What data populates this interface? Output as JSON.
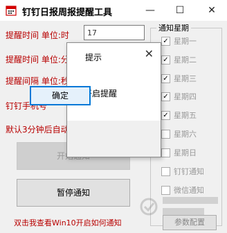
{
  "window": {
    "title": "钉钉日报周报提醒工具",
    "minimize": "—",
    "maximize": "☐",
    "close": "✕"
  },
  "form": {
    "row1_label": "提醒时间 单位:时",
    "row1_value": "17",
    "row2_label": "提醒时间 单位:分",
    "row3_label": "提醒间隔 单位:秒",
    "phone_label": "钉钉手机号",
    "auto_label": "默认3分钟后自动"
  },
  "buttons": {
    "start": "开始通知",
    "pause": "暂停通知",
    "config": "参数配置"
  },
  "help_link": "双击我查看Win10开启如何通知",
  "notify_group": {
    "legend": "通知星期",
    "items": [
      {
        "label": "星期一",
        "checked": "✓",
        "dim": true
      },
      {
        "label": "星期二",
        "checked": "✓",
        "dim": true
      },
      {
        "label": "星期三",
        "checked": "✓",
        "dim": true
      },
      {
        "label": "星期四",
        "checked": "✓",
        "dim": true
      },
      {
        "label": "星期五",
        "checked": "✓",
        "dim": true
      },
      {
        "label": "星期六",
        "checked": "",
        "dim": true
      },
      {
        "label": "星期日",
        "checked": "",
        "dim": true
      },
      {
        "label": "钉钉通知",
        "checked": "",
        "dim": true
      },
      {
        "label": "微信通知",
        "checked": "",
        "dim": true
      }
    ]
  },
  "dialog": {
    "title": "提示",
    "close": "✕",
    "message": "已开启提醒",
    "ok": "确定"
  },
  "colors": {
    "label_red": "#b80000",
    "focus_blue": "#0078d7"
  }
}
